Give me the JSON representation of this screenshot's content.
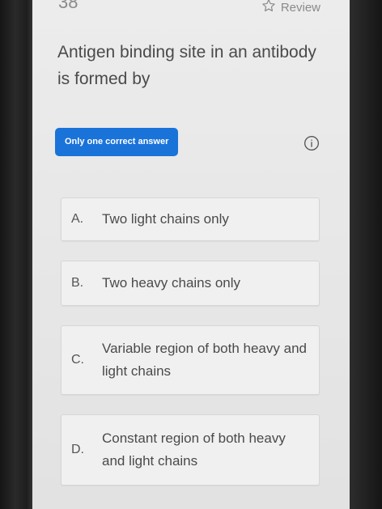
{
  "header": {
    "question_number": "38",
    "review_label": "Review",
    "review_icon": "star-outline-icon"
  },
  "question": {
    "text": "Antigen binding site in an antibody is formed by"
  },
  "answer_type": {
    "label": "Only one correct answer",
    "color": "#1a73d9",
    "info_icon": "info-circle-icon"
  },
  "options": [
    {
      "letter": "A.",
      "text": "Two light chains only"
    },
    {
      "letter": "B.",
      "text": "Two heavy chains only"
    },
    {
      "letter": "C.",
      "text": "Variable region of both heavy and light chains"
    },
    {
      "letter": "D.",
      "text": "Constant region of both heavy and light chains"
    }
  ]
}
